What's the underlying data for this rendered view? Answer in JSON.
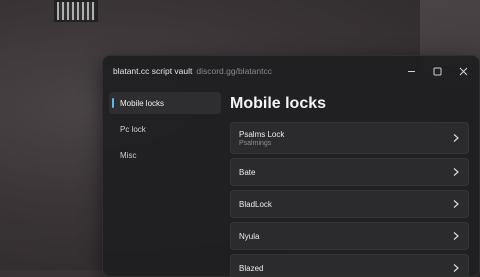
{
  "window": {
    "title": "blatant.cc script vault",
    "subtitle": "discord.gg/blatantcc"
  },
  "sidebar": {
    "items": [
      {
        "label": "Mobile locks",
        "active": true
      },
      {
        "label": "Pc lock",
        "active": false
      },
      {
        "label": "Misc",
        "active": false
      }
    ]
  },
  "main": {
    "heading": "Mobile locks",
    "scripts": [
      {
        "name": "Psalms Lock",
        "author": "Psalmings"
      },
      {
        "name": "Bate",
        "author": ""
      },
      {
        "name": "BladLock",
        "author": ""
      },
      {
        "name": "Nyula",
        "author": ""
      },
      {
        "name": "Blazed",
        "author": ""
      }
    ]
  },
  "icons": {
    "minimize": "minimize-icon",
    "maximize": "maximize-icon",
    "close": "close-icon",
    "row_arrow": "chevron-right-icon"
  },
  "colors": {
    "accent": "#5fb8e8",
    "window_bg": "#1e1e20",
    "row_bg": "#2b2b2d"
  }
}
